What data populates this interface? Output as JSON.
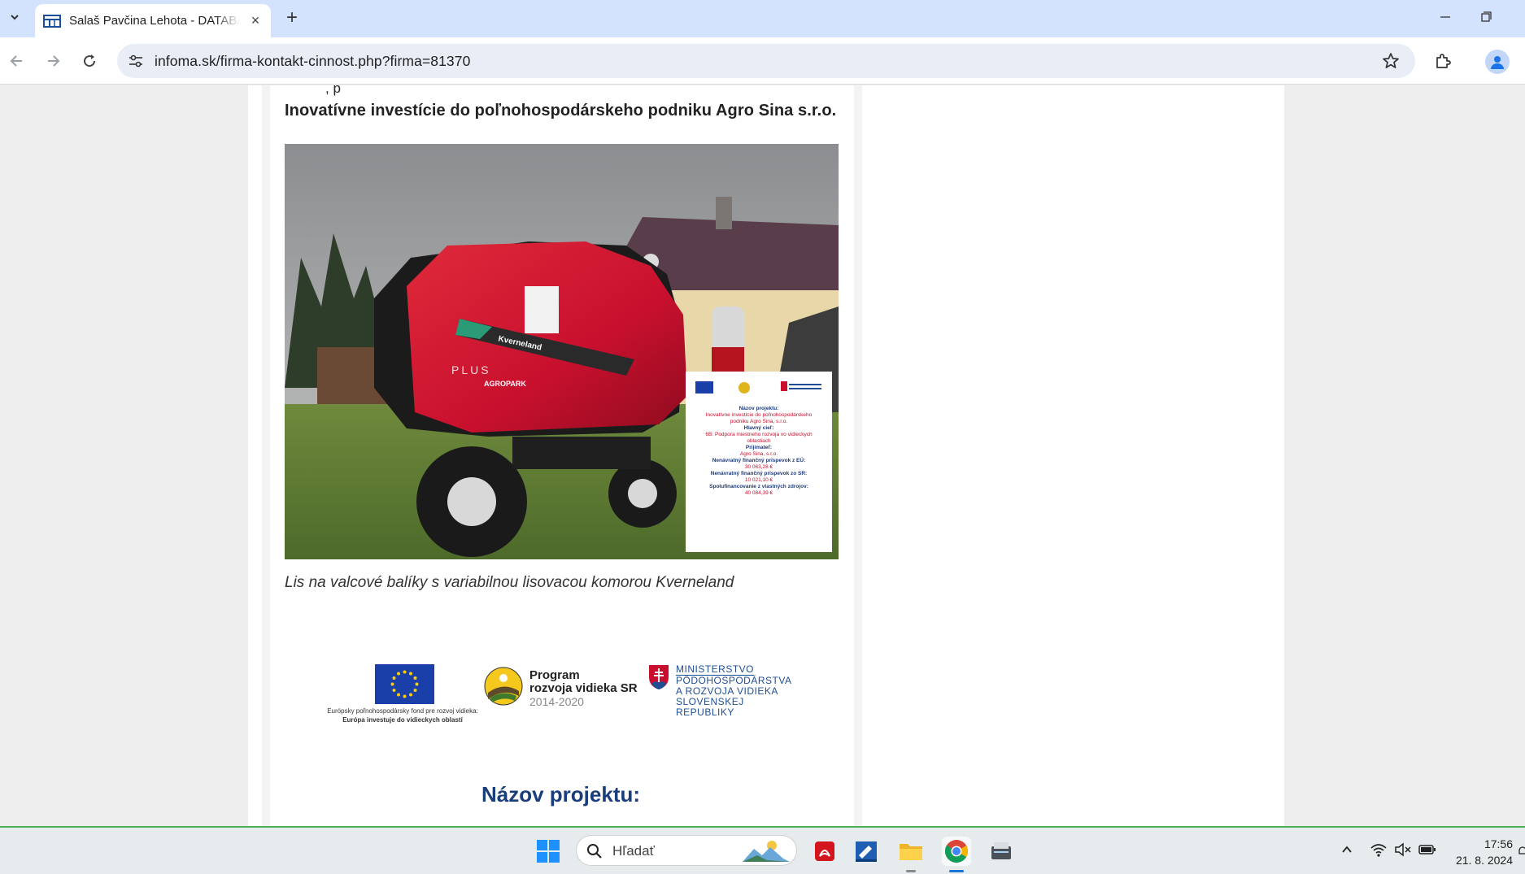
{
  "browser": {
    "tab_title": "Salaš Pavčina Lehota - DATABÁZA",
    "url": "infoma.sk/firma-kontakt-cinnost.php?firma=81370"
  },
  "page": {
    "cutoff_text": ", p",
    "article_title": "Inovatívne investície do poľnohospodárskeho podniku Agro Sina s.r.o.",
    "photo_caption": "Lis na valcové balíky s variabilnou lisovacou komorou Kverneland",
    "machine_brand": "Kverneland",
    "machine_model": "PLUS",
    "dealer_label": "AGROPARK",
    "poster": {
      "name_label": "Názov projektu:",
      "name_value": "Inovatívne investície do poľnohospodárskeho podniku Agro Sina, s.r.o.",
      "goal_label": "Hlavný cieľ:",
      "goal_value": "6B: Podpora miestneho rozvoja vo vidieckych oblastiach",
      "recipient_label": "Prijímateľ:",
      "recipient_value": "Agro Sina, s.r.o.",
      "eu_label": "Nenávratný finančný príspevok z EÚ:",
      "eu_value": "30 063,28 €",
      "sr_label": "Nenávratný finančný príspevok zo SR:",
      "sr_value": "10 021,10 €",
      "own_label": "Spolufinancovanie z vlastných zdrojov:",
      "own_value": "40 084,39 €"
    },
    "logos": {
      "eu_line1": "Európsky poľnohospodársky fond pre rozvoj vidieka:",
      "eu_line2": "Európa investuje do vidieckych oblastí",
      "prv_line1": "Program",
      "prv_line2": "rozvoja vidieka SR",
      "prv_years": "2014-2020",
      "ministry_line1": "MINISTERSTVO",
      "ministry_line2": "PÔDOHOSPODÁRSTVA",
      "ministry_line3": "A ROZVOJA VIDIEKA",
      "ministry_line4": "SLOVENSKEJ REPUBLIKY"
    },
    "project_heading": "Názov projektu:"
  },
  "taskbar": {
    "search_placeholder": "Hľadať",
    "time": "17:56",
    "date": "21. 8. 2024"
  },
  "colors": {
    "tabstrip": "#d3e3fd",
    "omnibox": "#e9eef6",
    "baler_red": "#c8102e",
    "project_heading": "#1a3d7c"
  }
}
